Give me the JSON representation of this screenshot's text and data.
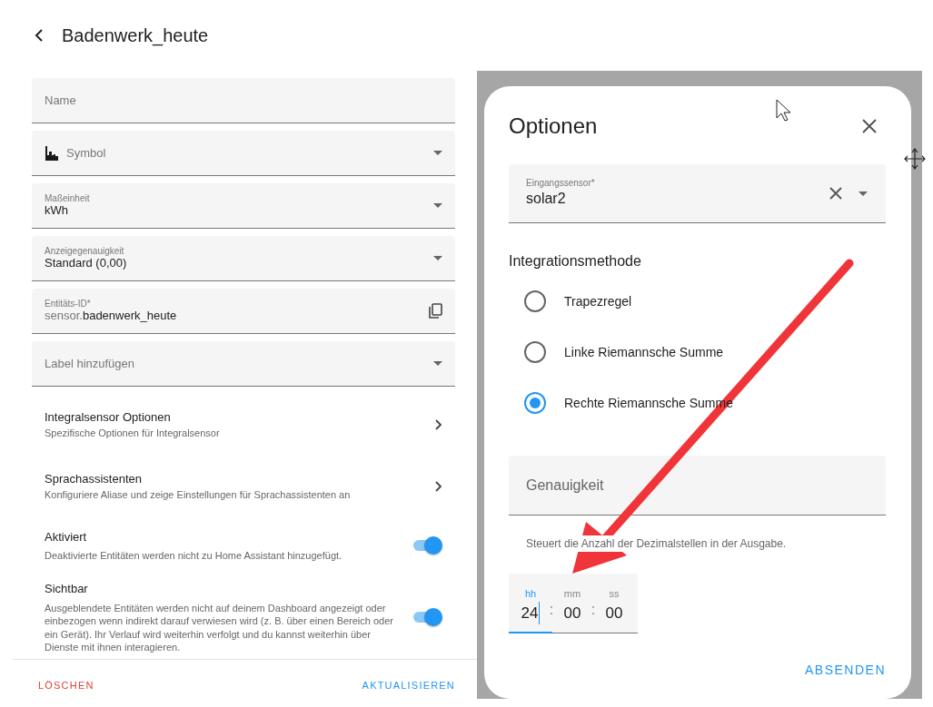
{
  "header": {
    "title": "Badenwerk_heute"
  },
  "fields": [
    {
      "kind": "text",
      "placeholder": "Name"
    },
    {
      "kind": "icon-select",
      "placeholder": "Symbol"
    },
    {
      "kind": "select",
      "label": "Maßeinheit",
      "value": "kWh"
    },
    {
      "kind": "select",
      "label": "Anzeigegenauigkeit",
      "value": "Standard (0,00)"
    },
    {
      "kind": "entity",
      "label": "Entitäts-ID*",
      "prefix": "sensor.",
      "value": "badenwerk_heute"
    },
    {
      "kind": "select",
      "placeholder": "Label hinzufügen"
    }
  ],
  "links": [
    {
      "title": "Integralsensor Optionen",
      "subtitle": "Spezifische Optionen für Integralsensor"
    },
    {
      "title": "Sprachassistenten",
      "subtitle": "Konfiguriere Aliase und zeige Einstellungen für Sprachassistenten an"
    }
  ],
  "toggles": [
    {
      "title": "Aktiviert",
      "description": "Deaktivierte Entitäten werden nicht zu Home Assistant hinzugefügt.",
      "on": true
    },
    {
      "title": "Sichtbar",
      "description": "Ausgeblendete Entitäten werden nicht auf deinem Dashboard angezeigt oder einbezogen wenn indirekt darauf verwiesen wird (z. B. über einen Bereich oder ein Gerät). Ihr Verlauf wird weiterhin verfolgt und du kannst weiterhin über Dienste mit ihnen interagieren.",
      "on": true
    }
  ],
  "footer": {
    "delete": "LÖSCHEN",
    "update": "AKTUALISIEREN"
  },
  "dialog": {
    "title": "Optionen",
    "input_sensor": {
      "label": "Eingangssensor*",
      "value": "solar2"
    },
    "method": {
      "heading": "Integrationsmethode",
      "options": [
        {
          "label": "Trapezregel",
          "selected": false
        },
        {
          "label": "Linke Riemannsche Summe",
          "selected": false
        },
        {
          "label": "Rechte Riemannsche Summe",
          "selected": true
        }
      ]
    },
    "precision": {
      "placeholder": "Genauigkeit",
      "helper": "Steuert die Anzahl der Dezimalstellen in der Ausgabe."
    },
    "duration": {
      "separators": [
        ":",
        ":"
      ],
      "fields": [
        {
          "label": "hh",
          "value": "24",
          "focused": true
        },
        {
          "label": "mm",
          "value": "00",
          "focused": false
        },
        {
          "label": "ss",
          "value": "00",
          "focused": false
        }
      ]
    },
    "submit": "ABSENDEN"
  }
}
